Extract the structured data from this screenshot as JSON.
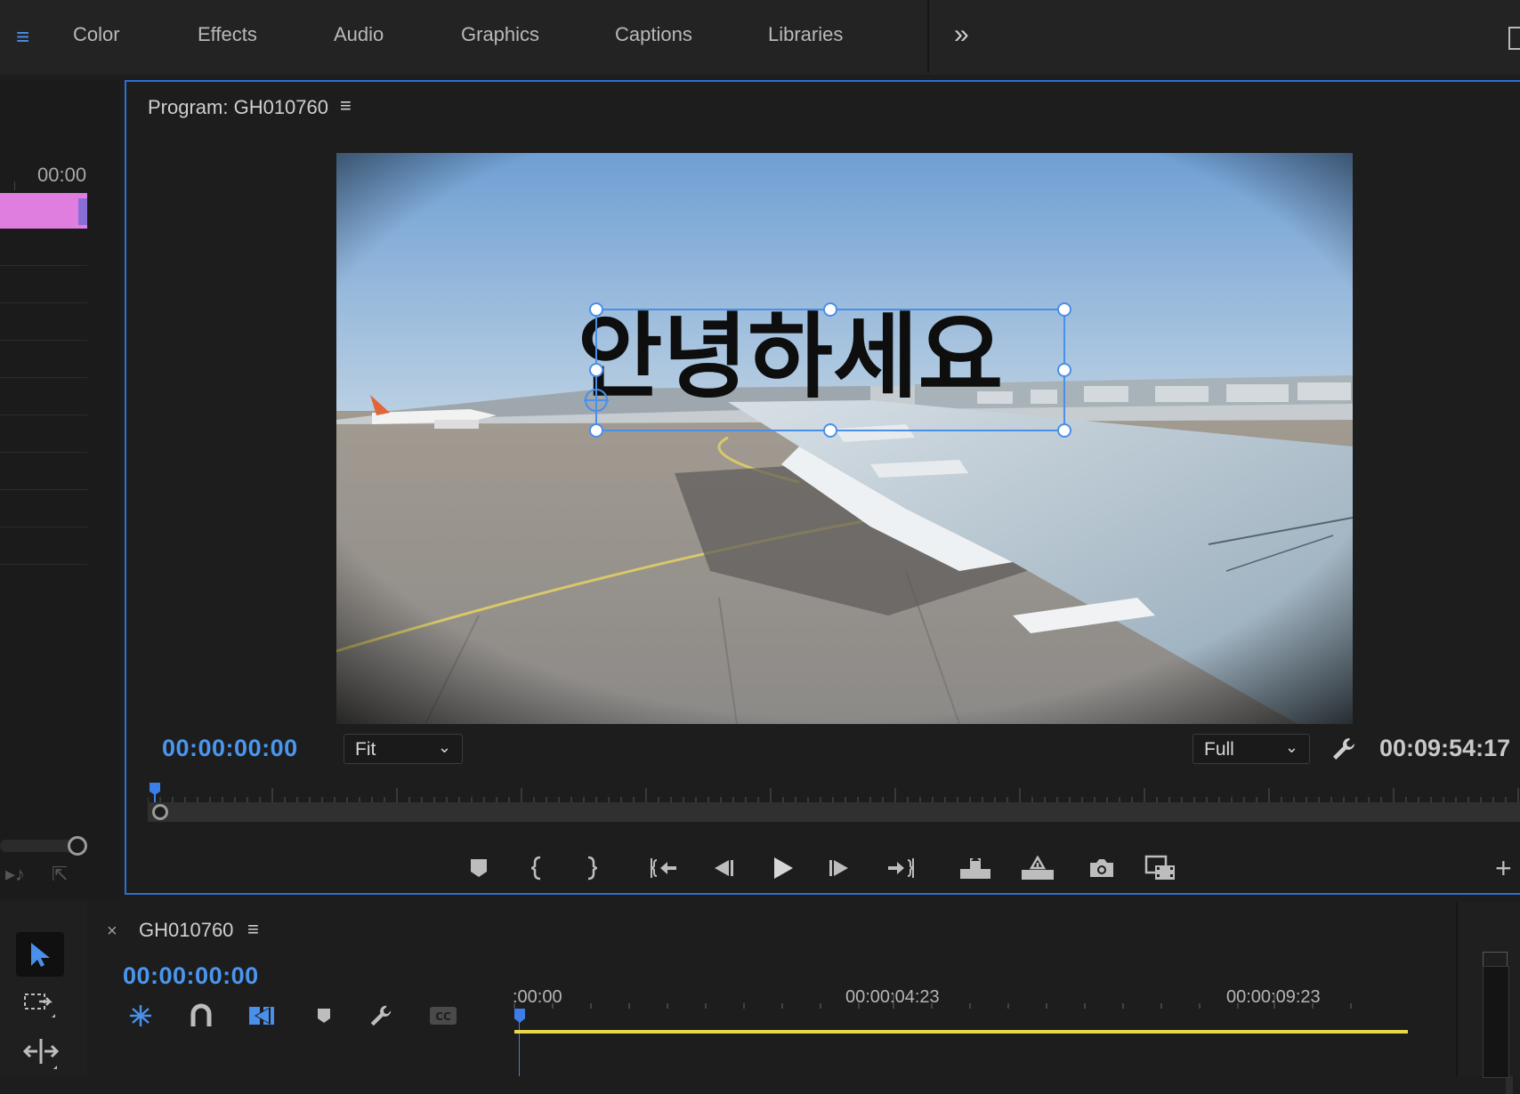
{
  "workspace": {
    "tabs": [
      "Color",
      "Effects",
      "Audio",
      "Graphics",
      "Captions",
      "Libraries"
    ],
    "overflow": "»"
  },
  "left_panel": {
    "timestamp": "00:00",
    "clip_color": "#e07ee0"
  },
  "program_monitor": {
    "title": "Program: GH010760",
    "overlay_text": "안녕하세요",
    "current_timecode": "00:00:00:00",
    "zoom": "Fit",
    "resolution": "Full",
    "duration_timecode": "00:09:54:17"
  },
  "transport": {
    "buttons": [
      "add-marker",
      "mark-in",
      "mark-out",
      "go-to-in",
      "step-back",
      "play",
      "step-forward",
      "go-to-out",
      "lift",
      "extract",
      "export-frame",
      "comparison-view"
    ]
  },
  "timeline": {
    "sequence_name": "GH010760",
    "timecode": "00:00:00:00",
    "ruler_labels": [
      ":00:00",
      "00:00:04:23",
      "00:00:09:23"
    ]
  },
  "colors": {
    "accent_blue": "#4a96f0",
    "panel_border": "#2e6ed6",
    "timeline_bar": "#e8d84a"
  }
}
